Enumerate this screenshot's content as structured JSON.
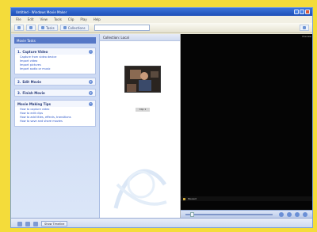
{
  "window": {
    "title": "Untitled - Windows Movie Maker"
  },
  "menu": {
    "items": [
      "File",
      "Edit",
      "View",
      "Tools",
      "Clip",
      "Play",
      "Help"
    ]
  },
  "toolbar": {
    "tasks_label": "Tasks",
    "collections_label": "Collections"
  },
  "task_pane": {
    "header": "Movie Tasks",
    "sections": [
      {
        "num": "1.",
        "title": "Capture Video",
        "items": [
          "Capture from video device",
          "Import video",
          "Import pictures",
          "Import audio or music"
        ]
      },
      {
        "num": "2.",
        "title": "Edit Movie",
        "items": []
      },
      {
        "num": "3.",
        "title": "Finish Movie",
        "items": []
      },
      {
        "num": "",
        "title": "Movie Making Tips",
        "items": [
          "How to capture video",
          "How to edit clips",
          "How to add titles, effects, transitions",
          "How to save and share movies"
        ]
      }
    ]
  },
  "collection": {
    "header": "Collection: Local",
    "clip_caption": "Clip 1"
  },
  "preview": {
    "top_text": "Preview",
    "status_text": "Paused"
  },
  "storyboard": {
    "label": "Show Timeline"
  },
  "colors": {
    "frame_yellow": "#f4dc3a",
    "title_blue": "#1e4fb8",
    "link_blue": "#2a55c8",
    "preview_black": "#050505"
  }
}
